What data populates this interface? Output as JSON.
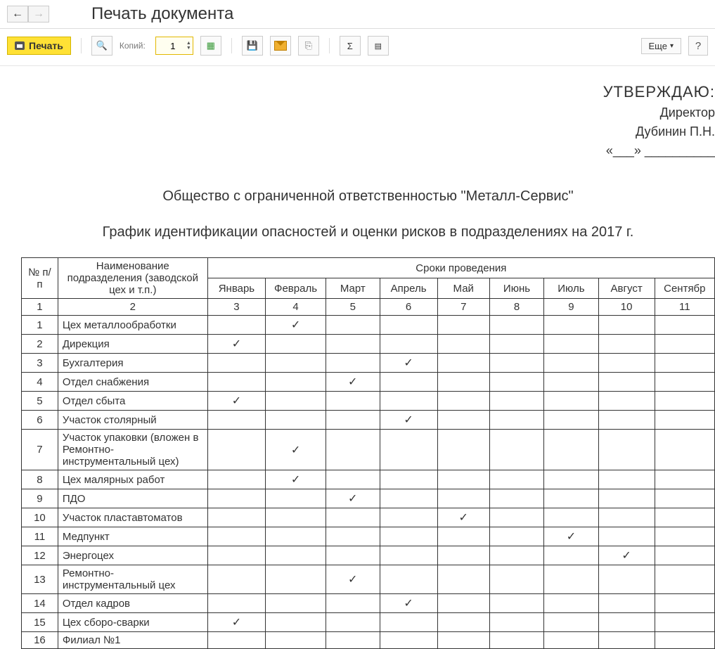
{
  "header": {
    "title": "Печать документа"
  },
  "toolbar": {
    "print_label": "Печать",
    "copies_label": "Копий:",
    "copies_value": "1",
    "more_label": "Еще"
  },
  "document": {
    "approve_title": "УТВЕРЖДАЮ:",
    "approve_position": "Директор",
    "approve_name": "Дубинин П.Н.",
    "approve_date_template": "«___» __________",
    "company": "Общество с ограниченной ответственностью \"Металл-Сервис\"",
    "title": "График идентификации опасностей и оценки рисков в подразделениях на 2017 г."
  },
  "table": {
    "col_num": "№ п/п",
    "col_name": "Наименование подразделения (заводской цех и т.п.)",
    "col_period": "Сроки проведения",
    "months": [
      "Январь",
      "Февраль",
      "Март",
      "Апрель",
      "Май",
      "Июнь",
      "Июль",
      "Август",
      "Сентябр"
    ],
    "numrow": [
      "1",
      "2",
      "3",
      "4",
      "5",
      "6",
      "7",
      "8",
      "9",
      "10",
      "11"
    ],
    "rows": [
      {
        "n": "1",
        "name": "Цех металлообработки",
        "marks": [
          0,
          1,
          0,
          0,
          0,
          0,
          0,
          0,
          0
        ]
      },
      {
        "n": "2",
        "name": "Дирекция",
        "marks": [
          1,
          0,
          0,
          0,
          0,
          0,
          0,
          0,
          0
        ]
      },
      {
        "n": "3",
        "name": "Бухгалтерия",
        "marks": [
          0,
          0,
          0,
          1,
          0,
          0,
          0,
          0,
          0
        ]
      },
      {
        "n": "4",
        "name": "Отдел снабжения",
        "marks": [
          0,
          0,
          1,
          0,
          0,
          0,
          0,
          0,
          0
        ]
      },
      {
        "n": "5",
        "name": "Отдел сбыта",
        "marks": [
          1,
          0,
          0,
          0,
          0,
          0,
          0,
          0,
          0
        ]
      },
      {
        "n": "6",
        "name": "Участок столярный",
        "marks": [
          0,
          0,
          0,
          1,
          0,
          0,
          0,
          0,
          0
        ]
      },
      {
        "n": "7",
        "name": "Участок упаковки (вложен в Ремонтно-инструментальный цех)",
        "marks": [
          0,
          1,
          0,
          0,
          0,
          0,
          0,
          0,
          0
        ]
      },
      {
        "n": "8",
        "name": "Цех малярных работ",
        "marks": [
          0,
          1,
          0,
          0,
          0,
          0,
          0,
          0,
          0
        ]
      },
      {
        "n": "9",
        "name": "ПДО",
        "marks": [
          0,
          0,
          1,
          0,
          0,
          0,
          0,
          0,
          0
        ]
      },
      {
        "n": "10",
        "name": "Участок пластавтоматов",
        "marks": [
          0,
          0,
          0,
          0,
          1,
          0,
          0,
          0,
          0
        ]
      },
      {
        "n": "11",
        "name": "Медпункт",
        "marks": [
          0,
          0,
          0,
          0,
          0,
          0,
          1,
          0,
          0
        ]
      },
      {
        "n": "12",
        "name": "Энергоцех",
        "marks": [
          0,
          0,
          0,
          0,
          0,
          0,
          0,
          1,
          0
        ]
      },
      {
        "n": "13",
        "name": "Ремонтно-инструментальный цех",
        "marks": [
          0,
          0,
          1,
          0,
          0,
          0,
          0,
          0,
          0
        ]
      },
      {
        "n": "14",
        "name": "Отдел кадров",
        "marks": [
          0,
          0,
          0,
          1,
          0,
          0,
          0,
          0,
          0
        ]
      },
      {
        "n": "15",
        "name": "Цех сборо-сварки",
        "marks": [
          1,
          0,
          0,
          0,
          0,
          0,
          0,
          0,
          0
        ]
      },
      {
        "n": "16",
        "name": "Филиал №1",
        "marks": [
          0,
          0,
          0,
          0,
          0,
          0,
          0,
          0,
          0
        ]
      }
    ]
  }
}
